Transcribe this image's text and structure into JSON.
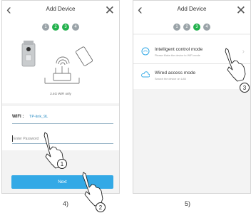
{
  "screens": [
    {
      "header": {
        "back_icon": "chevron-left-icon",
        "title": "Add Device",
        "close_icon": "close-icon"
      },
      "steps": [
        "1",
        "2",
        "3",
        "4"
      ],
      "active_steps": [
        2,
        3
      ],
      "illustration": {
        "label": "2.4G WiFi only",
        "icons": [
          "camera-icon",
          "wifi-signal-icon",
          "phone-icon",
          "router-icon"
        ]
      },
      "form": {
        "wifi_label": "WIFI :",
        "wifi_value": "TP-link_9L",
        "password_placeholder": "Enter Password"
      },
      "next_button": "Next",
      "caption": "4)"
    },
    {
      "header": {
        "back_icon": "chevron-left-icon",
        "title": "Add Device",
        "close_icon": "close-icon"
      },
      "steps": [
        "1",
        "2",
        "3",
        "4"
      ],
      "active_step": 3,
      "modes": [
        {
          "title": "Intelligent control mode",
          "subtitle": "Please Make the device to WiFi mode",
          "icon": "wifi-cloud-icon"
        },
        {
          "title": "Wired access mode",
          "subtitle": "Search the device on LAN",
          "icon": "cloud-icon"
        }
      ],
      "caption": "5)"
    }
  ],
  "markers": [
    "1",
    "2",
    "3"
  ],
  "colors": {
    "accent": "#33a9e6",
    "step_active": "#23b14d",
    "step_inactive": "#9aa3a8",
    "link": "#2f8fc4"
  }
}
